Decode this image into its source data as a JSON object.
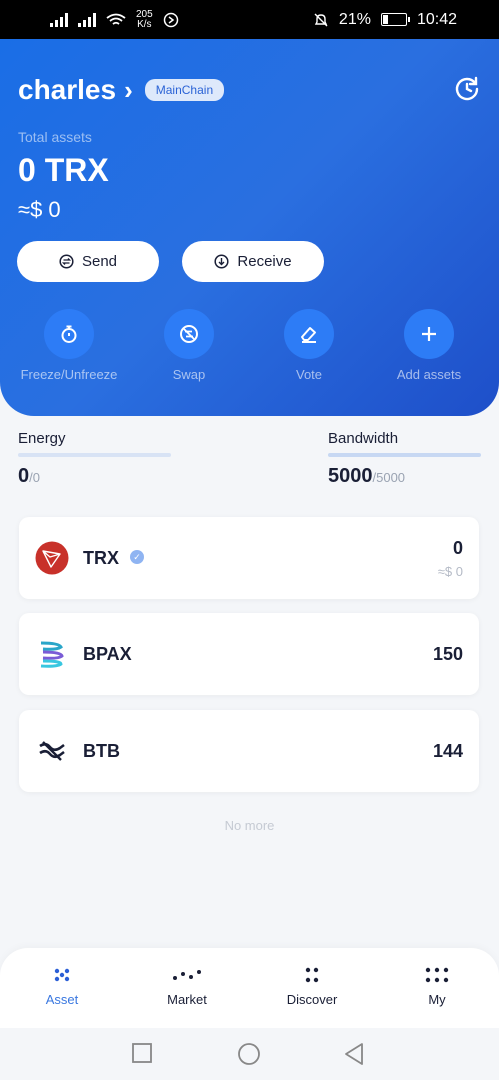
{
  "status_bar": {
    "speed_top": "205",
    "speed_bottom": "K/s",
    "battery": "21%",
    "time": "10:42"
  },
  "header": {
    "account_name": "charles",
    "chain_badge": "MainChain",
    "total_label": "Total assets",
    "total_value": "0 TRX",
    "fiat_value": "≈$ 0",
    "send_label": "Send",
    "receive_label": "Receive",
    "actions": [
      {
        "label": "Freeze/Unfreeze",
        "icon": "stopwatch-icon"
      },
      {
        "label": "Swap",
        "icon": "swap-icon"
      },
      {
        "label": "Vote",
        "icon": "eraser-icon"
      },
      {
        "label": "Add assets",
        "icon": "plus-icon"
      }
    ]
  },
  "resources": {
    "energy": {
      "label": "Energy",
      "value": "0",
      "max": "/0"
    },
    "bandwidth": {
      "label": "Bandwidth",
      "value": "5000",
      "max": "/5000"
    }
  },
  "tokens": [
    {
      "name": "TRX",
      "amount": "0",
      "fiat": "≈$ 0",
      "verified": true
    },
    {
      "name": "BPAX",
      "amount": "150"
    },
    {
      "name": "BTB",
      "amount": "144"
    }
  ],
  "no_more": "No more",
  "tabs": [
    {
      "label": "Asset",
      "active": true
    },
    {
      "label": "Market"
    },
    {
      "label": "Discover"
    },
    {
      "label": "My"
    }
  ],
  "colors": {
    "primary": "#2a6fe0",
    "accent": "#3a78e0",
    "trx_red": "#c8312a"
  }
}
